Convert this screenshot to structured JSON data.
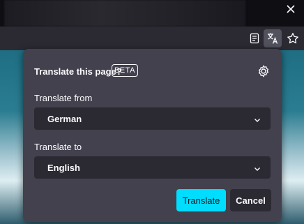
{
  "panel": {
    "title": "Translate this page?",
    "badge": "BETA",
    "from_label": "Translate from",
    "from_value": "German",
    "to_label": "Translate to",
    "to_value": "English",
    "translate_button": "Translate",
    "cancel_button": "Cancel"
  },
  "icons": {
    "settings": "gear-icon",
    "chevron": "chevron-down-icon",
    "reader": "reader-view-icon",
    "translate": "translate-icon",
    "bookmark": "star-icon",
    "close": "close-icon"
  },
  "colors": {
    "primary": "#00ddff",
    "panel_bg": "#42414d",
    "select_bg": "#2b2a33"
  }
}
